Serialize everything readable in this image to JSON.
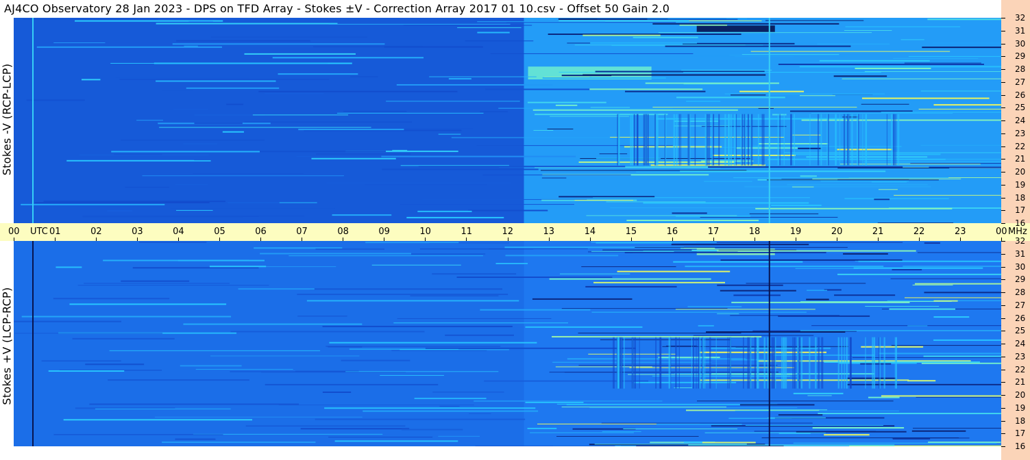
{
  "title": "AJ4CO Observatory  28 Jan 2023  -  DPS on TFD Array  -  Stokes ±V  -  Correction Array 2017 01 10.csv  -  Offset 50  Gain 2.0",
  "colors": {
    "background": "#ffffff",
    "axis_band": "#fdfdc0",
    "right_strip": "#fbd4b8",
    "base_blue": "#1f6fe0",
    "dark_blue": "#0a2a8a",
    "cyan": "#39d3ff",
    "yellow": "#e8f060"
  },
  "chart_data": [
    {
      "type": "heatmap",
      "name": "top-panel",
      "ylabel": "Stokes -V (RCP-LCP)",
      "x_unit": "UTC",
      "y_unit": "MHz",
      "xlim": [
        "00",
        "00"
      ],
      "ylim": [
        16,
        32
      ],
      "x_ticks": [
        "00",
        "01",
        "02",
        "03",
        "04",
        "05",
        "06",
        "07",
        "08",
        "09",
        "10",
        "11",
        "12",
        "13",
        "14",
        "15",
        "16",
        "17",
        "18",
        "19",
        "20",
        "21",
        "22",
        "23",
        "00"
      ],
      "y_ticks": [
        "16",
        "17",
        "18",
        "19",
        "20",
        "21",
        "22",
        "23",
        "24",
        "25",
        "26",
        "27",
        "28",
        "29",
        "30",
        "31",
        "32"
      ],
      "colormap": "blue-cyan-yellow",
      "regions": [
        {
          "t0": 0,
          "t1": 12.4,
          "f0": 16,
          "f1": 32,
          "level": 0.35
        },
        {
          "t0": 12.4,
          "t1": 24,
          "f0": 16,
          "f1": 32,
          "level": 0.6
        },
        {
          "t0": 16.6,
          "t1": 18.5,
          "f0": 30.9,
          "f1": 31.4,
          "level": 0.0
        },
        {
          "t0": 12.5,
          "t1": 15.5,
          "f0": 27.2,
          "f1": 28.2,
          "level": 0.85
        }
      ]
    },
    {
      "type": "heatmap",
      "name": "bottom-panel",
      "ylabel": "Stokes +V (LCP-RCP)",
      "x_unit": "UTC",
      "y_unit": "MHz",
      "xlim": [
        "00",
        "00"
      ],
      "ylim": [
        16,
        32
      ],
      "x_ticks": [
        "00",
        "01",
        "02",
        "03",
        "04",
        "05",
        "06",
        "07",
        "08",
        "09",
        "10",
        "11",
        "12",
        "13",
        "14",
        "15",
        "16",
        "17",
        "18",
        "19",
        "20",
        "21",
        "22",
        "23",
        "00"
      ],
      "y_ticks": [
        "16",
        "17",
        "18",
        "19",
        "20",
        "21",
        "22",
        "23",
        "24",
        "25",
        "26",
        "27",
        "28",
        "29",
        "30",
        "31",
        "32"
      ],
      "colormap": "blue-cyan-yellow",
      "regions": [
        {
          "t0": 0,
          "t1": 12.4,
          "f0": 16,
          "f1": 32,
          "level": 0.45
        },
        {
          "t0": 12.4,
          "t1": 24,
          "f0": 16,
          "f1": 32,
          "level": 0.5
        },
        {
          "t0": 16.6,
          "t1": 18.5,
          "f0": 30.9,
          "f1": 31.4,
          "level": 0.9
        }
      ]
    }
  ],
  "axis": {
    "utc_label": "UTC",
    "mhz_label": "MHz"
  }
}
